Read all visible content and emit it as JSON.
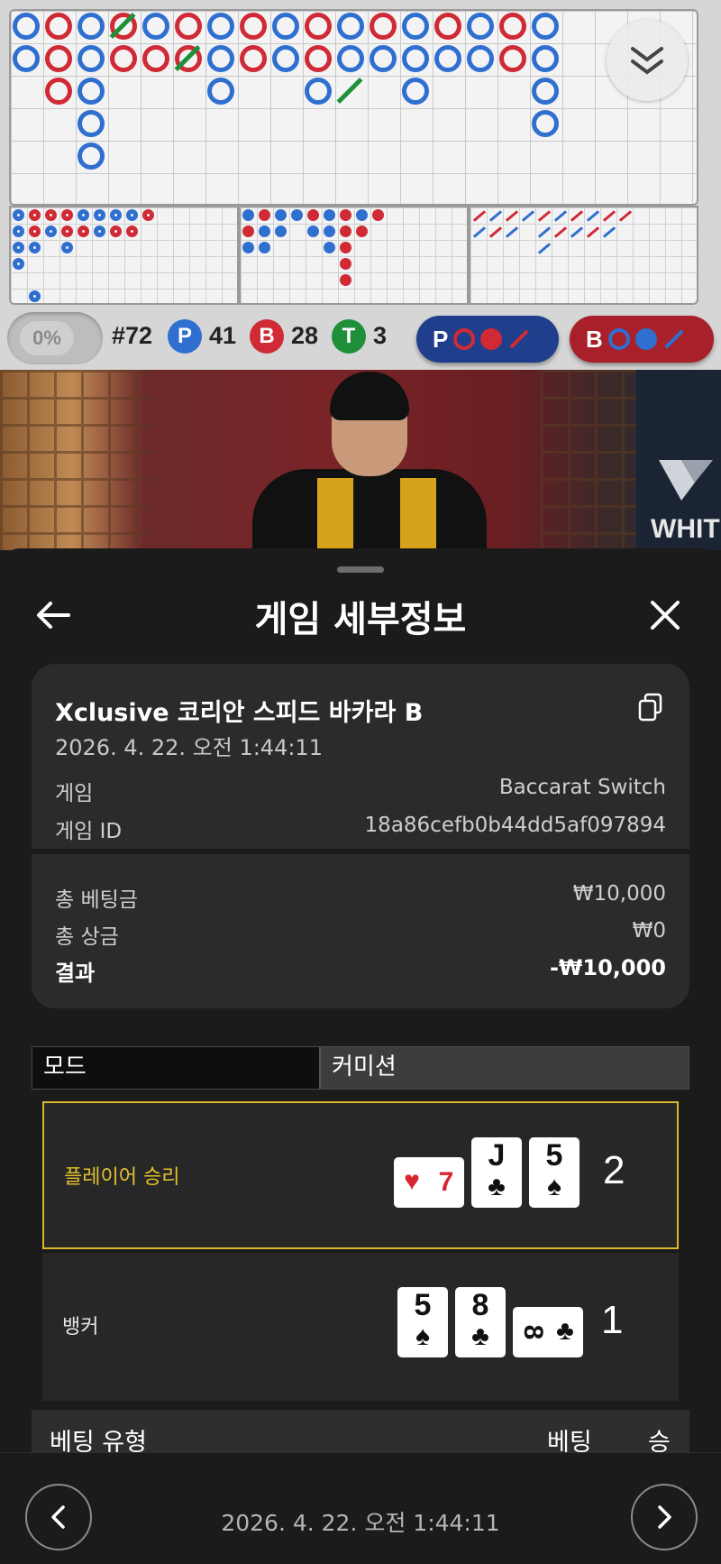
{
  "roadmap": {
    "shoe_percent": "0%",
    "round_number": "#72",
    "player": {
      "letter": "P",
      "count": "41"
    },
    "banker": {
      "letter": "B",
      "count": "28"
    },
    "tie": {
      "letter": "T",
      "count": "3"
    },
    "predict_player_label": "P",
    "predict_banker_label": "B",
    "colors": {
      "player": "#2f6fd0",
      "banker": "#cf2a35",
      "tie": "#1f8f3a"
    },
    "collapse_icon": "chevron-double-down-icon"
  },
  "video": {
    "brand_text": "WHITE"
  },
  "header": {
    "title": "게임 세부정보",
    "back_icon": "arrow-left-icon",
    "close_icon": "close-icon"
  },
  "summary": {
    "game_name": "Xclusive 코리안 스피드 바카라 B",
    "timestamp": "2026. 4. 22. 오전 1:44:11",
    "game_label": "게임",
    "game_value": "Baccarat Switch",
    "game_id_label": "게임 ID",
    "game_id_value": "18a86cefb0b44dd5af097894",
    "total_bet_label": "총 베팅금",
    "total_bet_value": "₩10,000",
    "total_win_label": "총 상금",
    "total_win_value": "₩0",
    "result_label": "결과",
    "result_value": "-₩10,000"
  },
  "tabs": {
    "mode": "모드",
    "commission": "커미션"
  },
  "hands": {
    "player": {
      "label": "플레이어 승리",
      "score": "2",
      "cards": [
        {
          "rank": "7",
          "suit": "♥",
          "sideways": true
        },
        {
          "rank": "J",
          "suit": "♣"
        },
        {
          "rank": "5",
          "suit": "♠"
        }
      ]
    },
    "banker": {
      "label": "뱅커",
      "score": "1",
      "cards": [
        {
          "rank": "5",
          "suit": "♠"
        },
        {
          "rank": "8",
          "suit": "♣"
        },
        {
          "rank": "8",
          "suit": "♣",
          "sideways": true
        }
      ]
    }
  },
  "bets_table": {
    "col_type": "베팅 유형",
    "col_bet": "베팅",
    "col_win": "승"
  },
  "footer": {
    "timestamp": "2026. 4. 22. 오전 1:44:11"
  }
}
